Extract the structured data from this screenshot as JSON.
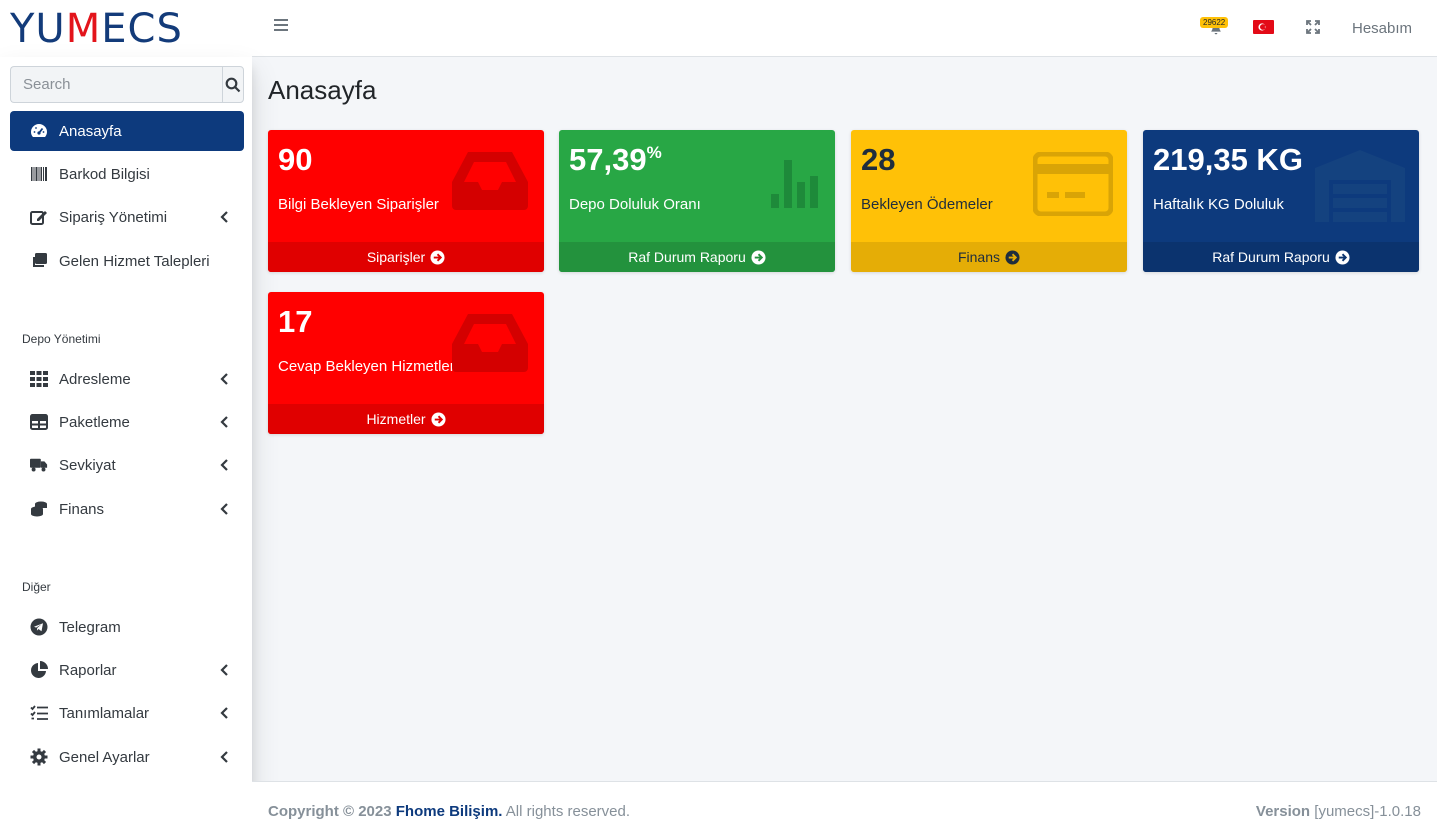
{
  "brand": {
    "logo_part1": "YU",
    "logo_part2": "M",
    "logo_part3": "ECS"
  },
  "topbar": {
    "notification_count": "29622",
    "account_label": "Hesabım"
  },
  "sidebar": {
    "search_placeholder": "Search",
    "items": [
      {
        "label": "Anasayfa",
        "icon": "tachometer-icon",
        "active": true
      },
      {
        "label": "Barkod Bilgisi",
        "icon": "barcode-icon"
      },
      {
        "label": "Sipariş Yönetimi",
        "icon": "edit-icon",
        "has_children": true
      },
      {
        "label": "Gelen Hizmet Talepleri",
        "icon": "clone-icon"
      }
    ],
    "section_depo": "Depo Yönetimi",
    "depo_items": [
      {
        "label": "Adresleme",
        "icon": "grid-icon"
      },
      {
        "label": "Paketleme",
        "icon": "table-icon"
      },
      {
        "label": "Sevkiyat",
        "icon": "truck-icon"
      },
      {
        "label": "Finans",
        "icon": "coins-icon"
      }
    ],
    "section_diger": "Diğer",
    "diger_items": [
      {
        "label": "Telegram",
        "icon": "telegram-icon",
        "has_children": false
      },
      {
        "label": "Raporlar",
        "icon": "chart-pie-icon",
        "has_children": true
      },
      {
        "label": "Tanımlamalar",
        "icon": "tasks-icon",
        "has_children": true
      },
      {
        "label": "Genel Ayarlar",
        "icon": "gear-icon",
        "has_children": true
      }
    ]
  },
  "page": {
    "title": "Anasayfa"
  },
  "cards": [
    {
      "value": "90",
      "label": "Bilgi Bekleyen Siparişler",
      "link": "Siparişler",
      "color": "#ff0000",
      "icon": "inbox-icon"
    },
    {
      "value": "57,39",
      "value_suffix": "%",
      "label": "Depo Doluluk Oranı",
      "link": "Raf Durum Raporu",
      "color": "#28a745",
      "icon": "bar-chart-icon"
    },
    {
      "value": "28",
      "label": "Bekleyen Ödemeler",
      "link": "Finans",
      "color": "#ffc107",
      "icon": "credit-card-icon"
    },
    {
      "value": "219,35 KG",
      "label": "Haftalık KG Doluluk",
      "link": "Raf Durum Raporu",
      "color": "#0d3a7d",
      "icon": "warehouse-icon"
    },
    {
      "value": "17",
      "label": "Cevap Bekleyen Hizmetler",
      "link": "Hizmetler",
      "color": "#ff0000",
      "icon": "inbox-icon"
    }
  ],
  "footer": {
    "copyright": "Copyright © 2023",
    "company": "Fhome Bilişim.",
    "rights": "All rights reserved.",
    "version_label": "Version",
    "version_value": "[yumecs]-1.0.18"
  }
}
